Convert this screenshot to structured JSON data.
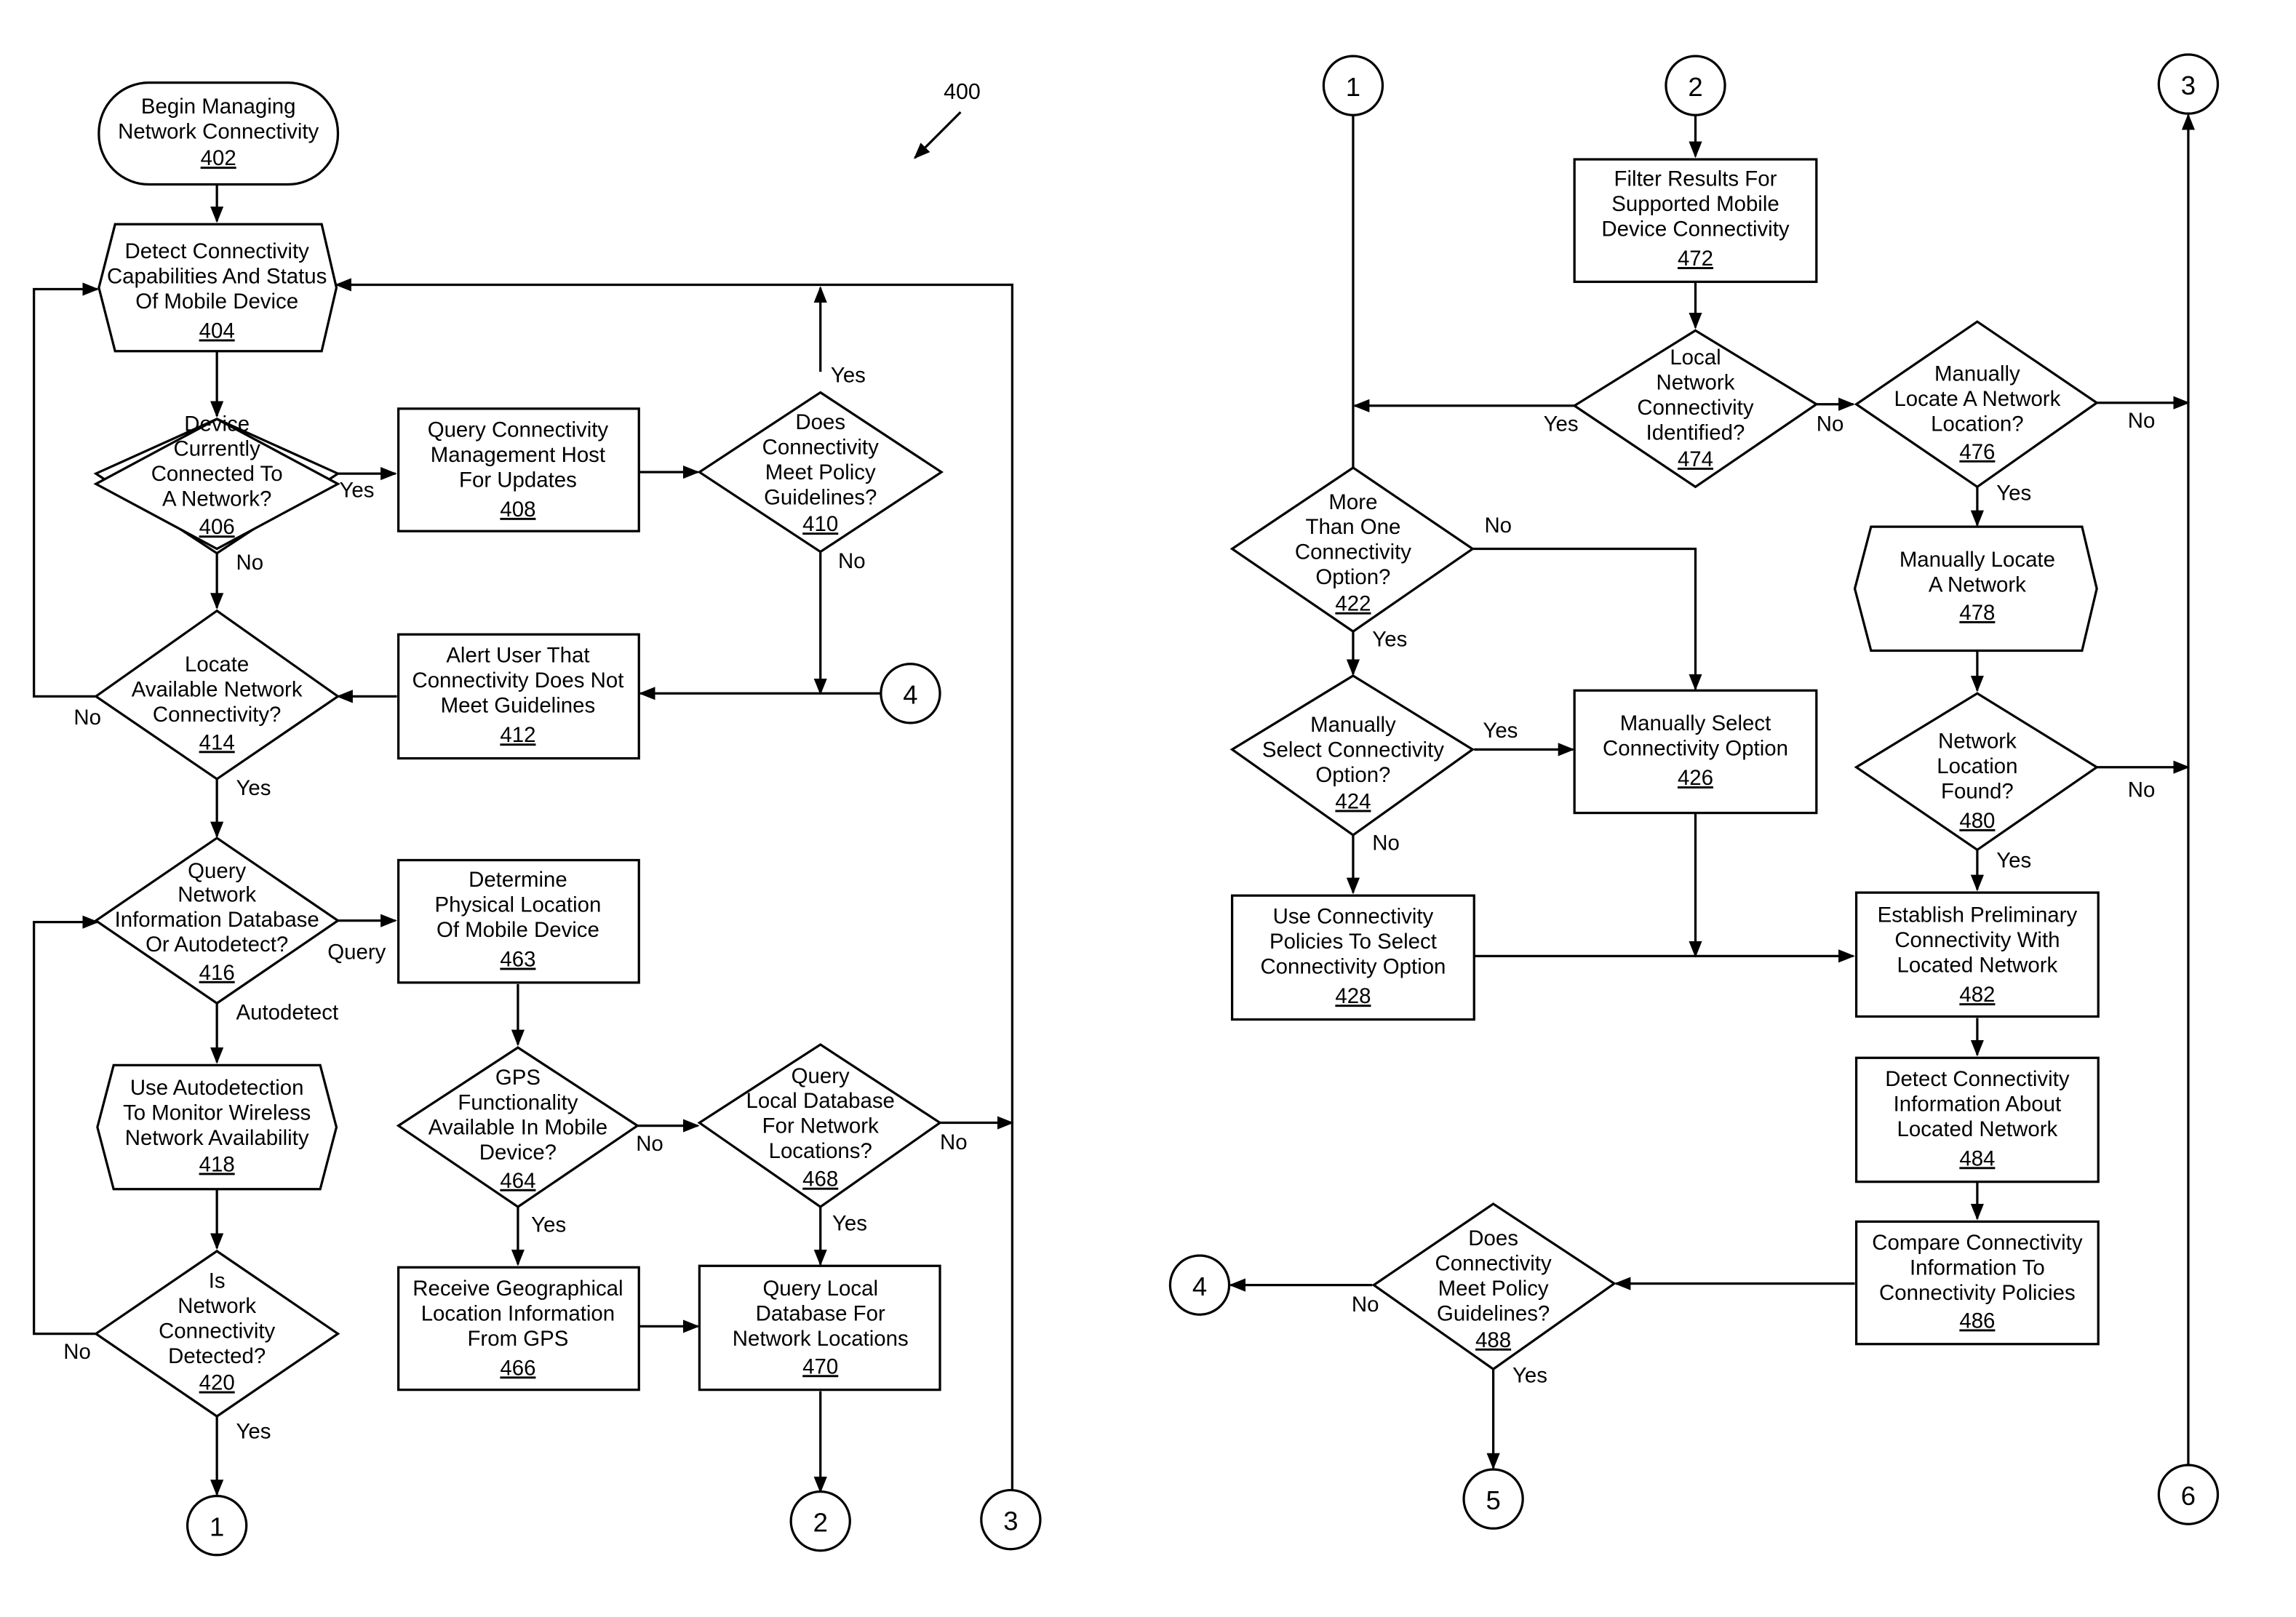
{
  "figure_ref": "400",
  "nodes": {
    "n402": {
      "lines": [
        "Begin Managing",
        "Network Connectivity"
      ],
      "num": "402"
    },
    "n404": {
      "lines": [
        "Detect Connectivity",
        "Capabilities And Status",
        "Of Mobile Device"
      ],
      "num": "404"
    },
    "n406": {
      "lines": [
        "Device",
        "Currently",
        "Connected To",
        "A Network?"
      ],
      "num": "406"
    },
    "n408": {
      "lines": [
        "Query Connectivity",
        "Management Host",
        "For Updates"
      ],
      "num": "408"
    },
    "n410": {
      "lines": [
        "Does",
        "Connectivity",
        "Meet Policy",
        "Guidelines?"
      ],
      "num": "410"
    },
    "n412": {
      "lines": [
        "Alert User That",
        "Connectivity Does Not",
        "Meet Guidelines"
      ],
      "num": "412"
    },
    "n414": {
      "lines": [
        "Locate",
        "Available Network",
        "Connectivity?"
      ],
      "num": "414"
    },
    "n416": {
      "lines": [
        "Query",
        "Network",
        "Information Database",
        "Or Autodetect?"
      ],
      "num": "416"
    },
    "n418": {
      "lines": [
        "Use Autodetection",
        "To Monitor Wireless",
        "Network Availability"
      ],
      "num": "418"
    },
    "n420": {
      "lines": [
        "Is",
        "Network",
        "Connectivity",
        "Detected?"
      ],
      "num": "420"
    },
    "n463": {
      "lines": [
        "Determine",
        "Physical Location",
        "Of Mobile Device"
      ],
      "num": "463"
    },
    "n464": {
      "lines": [
        "GPS",
        "Functionality",
        "Available In Mobile",
        "Device?"
      ],
      "num": "464"
    },
    "n466": {
      "lines": [
        "Receive Geographical",
        "Location Information",
        "From GPS"
      ],
      "num": "466"
    },
    "n468": {
      "lines": [
        "Query",
        "Local Database",
        "For Network",
        "Locations?"
      ],
      "num": "468"
    },
    "n470": {
      "lines": [
        "Query Local",
        "Database For",
        "Network Locations"
      ],
      "num": "470"
    },
    "n472": {
      "lines": [
        "Filter Results For",
        "Supported Mobile",
        "Device Connectivity"
      ],
      "num": "472"
    },
    "n474": {
      "lines": [
        "Local",
        "Network",
        "Connectivity",
        "Identified?"
      ],
      "num": "474"
    },
    "n476": {
      "lines": [
        "Manually",
        "Locate A Network",
        "Location?"
      ],
      "num": "476"
    },
    "n478": {
      "lines": [
        "Manually Locate",
        "A Network"
      ],
      "num": "478"
    },
    "n480": {
      "lines": [
        "Network",
        "Location",
        "Found?"
      ],
      "num": "480"
    },
    "n482": {
      "lines": [
        "Establish Preliminary",
        "Connectivity With",
        "Located Network"
      ],
      "num": "482"
    },
    "n484": {
      "lines": [
        "Detect Connectivity",
        "Information About",
        "Located Network"
      ],
      "num": "484"
    },
    "n486": {
      "lines": [
        "Compare Connectivity",
        "Information To",
        "Connectivity Policies"
      ],
      "num": "486"
    },
    "n488": {
      "lines": [
        "Does",
        "Connectivity",
        "Meet Policy",
        "Guidelines?"
      ],
      "num": "488"
    },
    "n422": {
      "lines": [
        "More",
        "Than One",
        "Connectivity",
        "Option?"
      ],
      "num": "422"
    },
    "n424": {
      "lines": [
        "Manually",
        "Select Connectivity",
        "Option?"
      ],
      "num": "424"
    },
    "n426": {
      "lines": [
        "Manually Select",
        "Connectivity Option"
      ],
      "num": "426"
    },
    "n428": {
      "lines": [
        "Use Connectivity",
        "Policies To Select",
        "Connectivity Option"
      ],
      "num": "428"
    }
  },
  "connectors": {
    "c1_out": "1",
    "c2_out": "2",
    "c3_out": "3",
    "c4_in": "4",
    "c1_in": "1",
    "c2_in": "2",
    "c3_in": "3",
    "c4_out": "4",
    "c5_out": "5",
    "c6_in": "6"
  },
  "edge_labels": {
    "yes": "Yes",
    "no": "No",
    "query": "Query",
    "autodetect": "Autodetect"
  }
}
